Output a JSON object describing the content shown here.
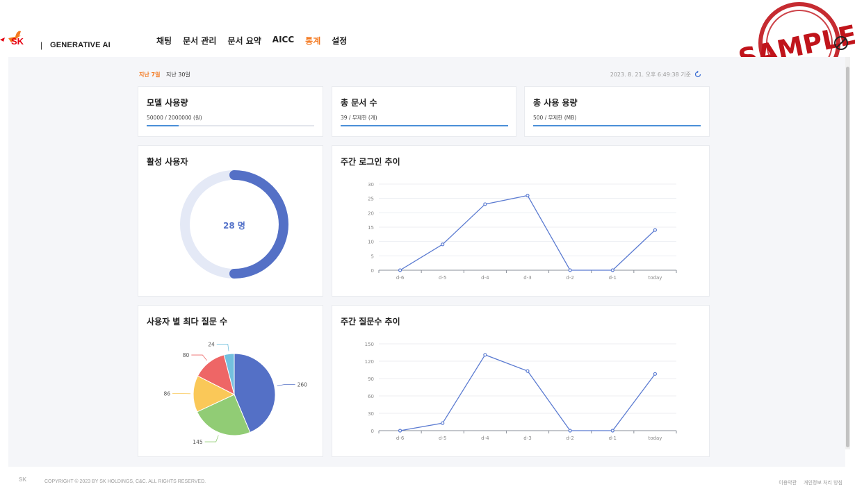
{
  "header": {
    "logo_text": "SK",
    "brand": "GENERATIVE AI",
    "nav": [
      {
        "label": "채팅",
        "active": false
      },
      {
        "label": "문서 관리",
        "active": false
      },
      {
        "label": "문서 요약",
        "active": false
      },
      {
        "label": "AICC",
        "active": false
      },
      {
        "label": "통계",
        "active": true
      },
      {
        "label": "설정",
        "active": false
      }
    ],
    "stamp_text": "SAMPLE"
  },
  "toolbar": {
    "period_7": "지난 7일",
    "period_30": "지난 30일",
    "timestamp": "2023. 8. 21. 오후 6:49:38 기준"
  },
  "summary_cards": [
    {
      "title": "모델 사용량",
      "sub": "50000 / 2000000 (원)",
      "progress": 0.19
    },
    {
      "title": "총 문서 수",
      "sub": "39 / 무제한 (개)",
      "progress": 1.0
    },
    {
      "title": "총 사용 용량",
      "sub": "500 / 무제한 (MB)",
      "progress": 1.0
    }
  ],
  "active_users": {
    "title": "활성 사용자",
    "value_label": "28 명",
    "progress": 0.5
  },
  "login_chart_title": "주간 로그인 추이",
  "question_chart_title": "주간 질문수 추이",
  "pie_title": "사용자 별 최다 질문 수",
  "chart_data": [
    {
      "type": "line",
      "title": "주간 로그인 추이",
      "categories": [
        "d-6",
        "d-5",
        "d-4",
        "d-3",
        "d-2",
        "d-1",
        "today"
      ],
      "values": [
        0,
        9,
        23,
        26,
        0,
        0,
        14
      ],
      "ylim": [
        0,
        30
      ],
      "yticks": [
        0,
        5,
        10,
        15,
        20,
        25,
        30
      ],
      "color": "#5b7bd1"
    },
    {
      "type": "line",
      "title": "주간 질문수 추이",
      "categories": [
        "d-6",
        "d-5",
        "d-4",
        "d-3",
        "d-2",
        "d-1",
        "today"
      ],
      "values": [
        0,
        13,
        131,
        103,
        0,
        0,
        98
      ],
      "ylim": [
        0,
        150
      ],
      "yticks": [
        0,
        30,
        60,
        90,
        120,
        150
      ],
      "color": "#5b7bd1"
    },
    {
      "type": "pie",
      "title": "사용자 별 최다 질문 수",
      "slices": [
        {
          "label": "260",
          "value": 260,
          "color": "#5470c6"
        },
        {
          "label": "145",
          "value": 145,
          "color": "#91cc75"
        },
        {
          "label": "86",
          "value": 86,
          "color": "#fac858"
        },
        {
          "label": "80",
          "value": 80,
          "color": "#ee6666"
        },
        {
          "label": "24",
          "value": 24,
          "color": "#73c0de"
        }
      ]
    }
  ],
  "footer": {
    "logo": "SK",
    "copyright": "COPYRIGHT © 2023 BY SK HOLDINGS, C&C. ALL RIGHTS RESERVED.",
    "terms": "이용약관",
    "privacy": "개인정보 처리 방침"
  }
}
